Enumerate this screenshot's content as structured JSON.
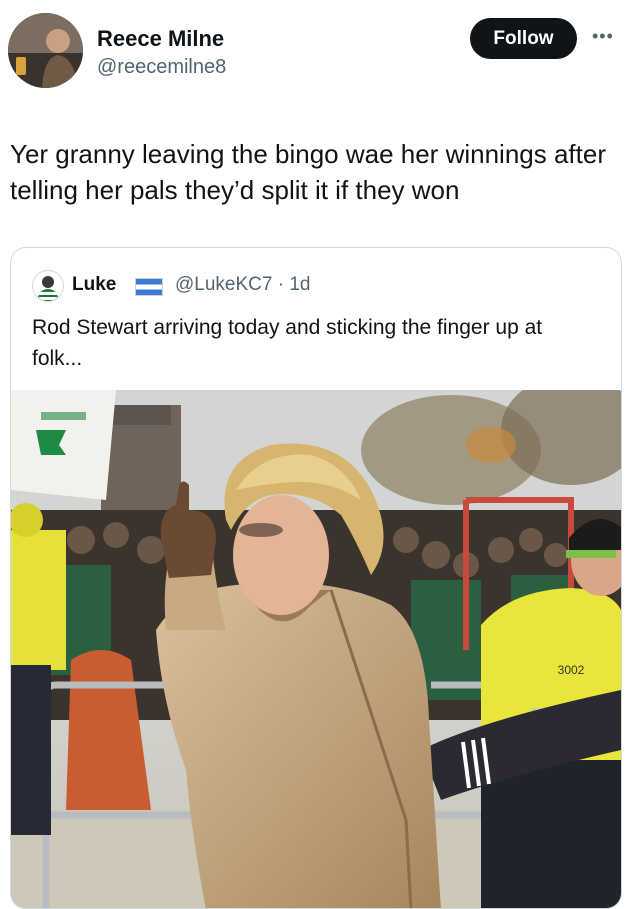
{
  "author": {
    "name": "Reece Milne",
    "handle": "@reecemilne8",
    "avatar_icon": "profile-photo"
  },
  "actions": {
    "follow_label": "Follow",
    "more_icon": "more-icon"
  },
  "tweet": {
    "text": "Yer granny leaving the bingo wae her winnings after telling her pals they’d split it if they won"
  },
  "quoted_tweet": {
    "name": "Luke",
    "flag_icon": "flag-icon",
    "handle_time": "@LukeKC7 · 1d",
    "text": "Rod Stewart arriving today and sticking the finger up at folk...",
    "photo": {
      "vest_number": "3002"
    }
  },
  "colors": {
    "follow_bg": "#0f1419",
    "handle_gray": "#536471",
    "border": "#cfd9de"
  }
}
